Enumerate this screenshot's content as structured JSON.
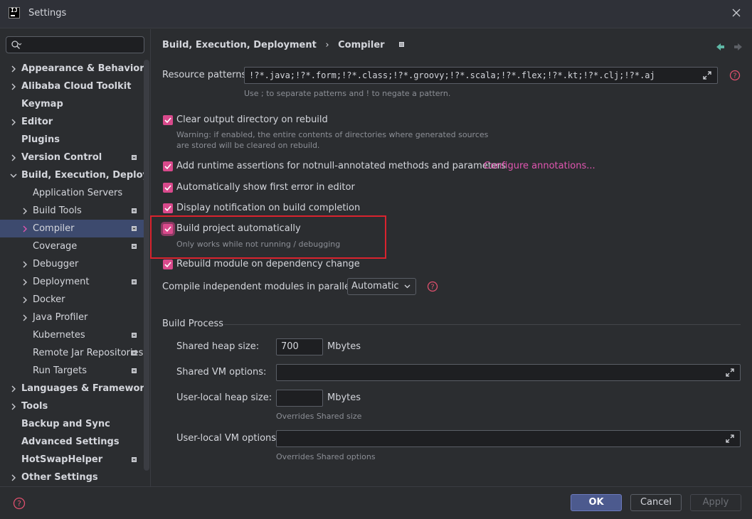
{
  "window": {
    "title": "Settings"
  },
  "search": {
    "placeholder": ""
  },
  "sidebar": {
    "items": [
      {
        "label": "Appearance & Behavior",
        "level": 0,
        "expandable": true,
        "bold": true,
        "badge": false
      },
      {
        "label": "Alibaba Cloud Toolkit",
        "level": 0,
        "expandable": true,
        "bold": true,
        "badge": false
      },
      {
        "label": "Keymap",
        "level": 0,
        "expandable": false,
        "bold": true,
        "badge": false
      },
      {
        "label": "Editor",
        "level": 0,
        "expandable": true,
        "bold": true,
        "badge": false
      },
      {
        "label": "Plugins",
        "level": 0,
        "expandable": false,
        "bold": true,
        "badge": false
      },
      {
        "label": "Version Control",
        "level": 0,
        "expandable": true,
        "bold": true,
        "badge": true
      },
      {
        "label": "Build, Execution, Deployment",
        "level": 0,
        "expandable": true,
        "expanded": true,
        "bold": true,
        "badge": false
      },
      {
        "label": "Application Servers",
        "level": 1,
        "expandable": false,
        "bold": false,
        "badge": false
      },
      {
        "label": "Build Tools",
        "level": 1,
        "expandable": true,
        "bold": false,
        "badge": true
      },
      {
        "label": "Compiler",
        "level": 1,
        "expandable": true,
        "bold": false,
        "badge": true,
        "selected": true
      },
      {
        "label": "Coverage",
        "level": 1,
        "expandable": false,
        "bold": false,
        "badge": true
      },
      {
        "label": "Debugger",
        "level": 1,
        "expandable": true,
        "bold": false,
        "badge": false
      },
      {
        "label": "Deployment",
        "level": 1,
        "expandable": true,
        "bold": false,
        "badge": true
      },
      {
        "label": "Docker",
        "level": 1,
        "expandable": true,
        "bold": false,
        "badge": false
      },
      {
        "label": "Java Profiler",
        "level": 1,
        "expandable": true,
        "bold": false,
        "badge": false
      },
      {
        "label": "Kubernetes",
        "level": 1,
        "expandable": false,
        "bold": false,
        "badge": true
      },
      {
        "label": "Remote Jar Repositories",
        "level": 1,
        "expandable": false,
        "bold": false,
        "badge": true
      },
      {
        "label": "Run Targets",
        "level": 1,
        "expandable": false,
        "bold": false,
        "badge": true
      },
      {
        "label": "Languages & Frameworks",
        "level": 0,
        "expandable": true,
        "bold": true,
        "badge": false
      },
      {
        "label": "Tools",
        "level": 0,
        "expandable": true,
        "bold": true,
        "badge": false
      },
      {
        "label": "Backup and Sync",
        "level": 0,
        "expandable": false,
        "bold": true,
        "badge": false
      },
      {
        "label": "Advanced Settings",
        "level": 0,
        "expandable": false,
        "bold": true,
        "badge": false
      },
      {
        "label": "HotSwapHelper",
        "level": 0,
        "expandable": false,
        "bold": true,
        "badge": true
      },
      {
        "label": "Other Settings",
        "level": 0,
        "expandable": true,
        "bold": true,
        "badge": false
      }
    ]
  },
  "breadcrumb": {
    "parent": "Build, Execution, Deployment",
    "separator": "›",
    "current": "Compiler"
  },
  "resource": {
    "label": "Resource patterns:",
    "value": "!?*.java;!?*.form;!?*.class;!?*.groovy;!?*.scala;!?*.flex;!?*.kt;!?*.clj;!?*.aj",
    "hint": "Use ; to separate patterns and ! to negate a pattern."
  },
  "options": {
    "clear_output": {
      "label": "Clear output directory on rebuild",
      "checked": true,
      "warning1": "Warning: if enabled, the entire contents of directories where generated sources",
      "warning2": "are stored will be cleared on rebuild."
    },
    "runtime_assertions": {
      "label": "Add runtime assertions for notnull-annotated methods and parameters",
      "checked": true,
      "link": "Configure annotations..."
    },
    "show_first_error": {
      "label": "Automatically show first error in editor",
      "checked": true
    },
    "notify_build": {
      "label": "Display notification on build completion",
      "checked": true
    },
    "build_auto": {
      "label": "Build project automatically",
      "checked": true,
      "hint": "Only works while not running / debugging"
    },
    "rebuild_module": {
      "label": "Rebuild module on dependency change",
      "checked": true
    }
  },
  "parallel": {
    "label": "Compile independent modules in parallel:",
    "value": "Automatic"
  },
  "build_process": {
    "title": "Build Process",
    "shared_heap": {
      "label": "Shared heap size:",
      "value": "700",
      "unit": "Mbytes"
    },
    "shared_vm": {
      "label": "Shared VM options:",
      "value": ""
    },
    "local_heap": {
      "label": "User-local heap size:",
      "value": "",
      "unit": "Mbytes",
      "hint": "Overrides Shared size"
    },
    "local_vm": {
      "label": "User-local VM options:",
      "value": "",
      "hint": "Overrides Shared options"
    }
  },
  "footer": {
    "ok": "OK",
    "cancel": "Cancel",
    "apply": "Apply"
  },
  "colors": {
    "accent": "#d94a8c",
    "link": "#e056b0",
    "selection": "#3d4a6e",
    "highlight": "#d9232e"
  }
}
